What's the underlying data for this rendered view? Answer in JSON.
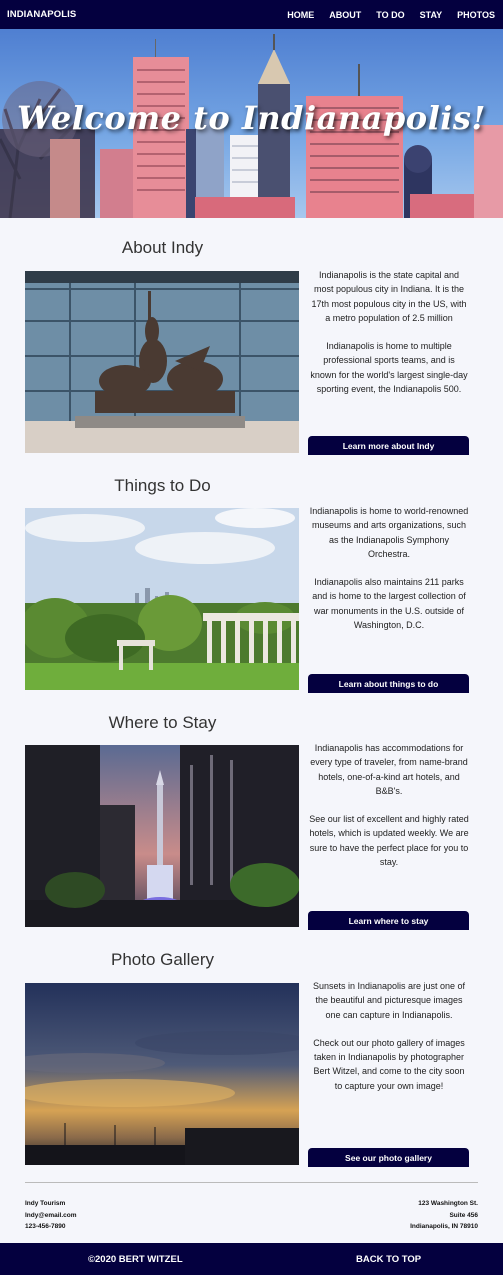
{
  "nav": {
    "brand": "INDIANAPOLIS",
    "links": [
      "HOME",
      "ABOUT",
      "TO DO",
      "STAY",
      "PHOTOS"
    ]
  },
  "hero": {
    "title": "Welcome to Indianapolis!"
  },
  "sections": [
    {
      "title": "About Indy",
      "paragraphs": [
        "Indianapolis is the state capital and most populous city in Indiana. It is the 17th most populous city in the US, with a metro population of 2.5 million",
        "Indianapolis is home to multiple professional sports teams, and is known for the world's largest single-day sporting event, the Indianapolis 500."
      ],
      "button": "Learn more about Indy"
    },
    {
      "title": "Things to Do",
      "paragraphs": [
        "Indianapolis is home to world-renowned museums and arts organizations, such as the Indianapolis Symphony Orchestra.",
        "Indianapolis also maintains 211 parks and is home to the largest collection of war monuments in the U.S. outside of Washington, D.C."
      ],
      "button": "Learn about things to do"
    },
    {
      "title": "Where to Stay",
      "paragraphs": [
        "Indianapolis has accommodations for every type of traveler, from name-brand hotels, one-of-a-kind art hotels, and B&B's.",
        "See our list of excellent and highly rated hotels, which is updated weekly. We are sure to have the perfect place for you to stay."
      ],
      "button": "Learn where to stay"
    },
    {
      "title": "Photo Gallery",
      "paragraphs": [
        "Sunsets in Indianapolis are just one of the beautiful and picturesque images one can capture in Indianapolis.",
        "Check out our photo gallery of images taken in Indianapolis by photographer Bert Witzel, and come to the city soon to capture your own image!"
      ],
      "button": "See our photo gallery"
    }
  ],
  "footer": {
    "contact_left": [
      "Indy Tourism",
      "Indy@email.com",
      "123-456-7890"
    ],
    "contact_right": [
      "123 Washington St.",
      "Suite 456",
      "Indianapolis, IN 78910"
    ],
    "copyright": "©2020 BERT WITZEL",
    "back_to_top": "BACK TO TOP"
  },
  "colors": {
    "navy": "#04003f",
    "background": "#f5f6fb"
  }
}
